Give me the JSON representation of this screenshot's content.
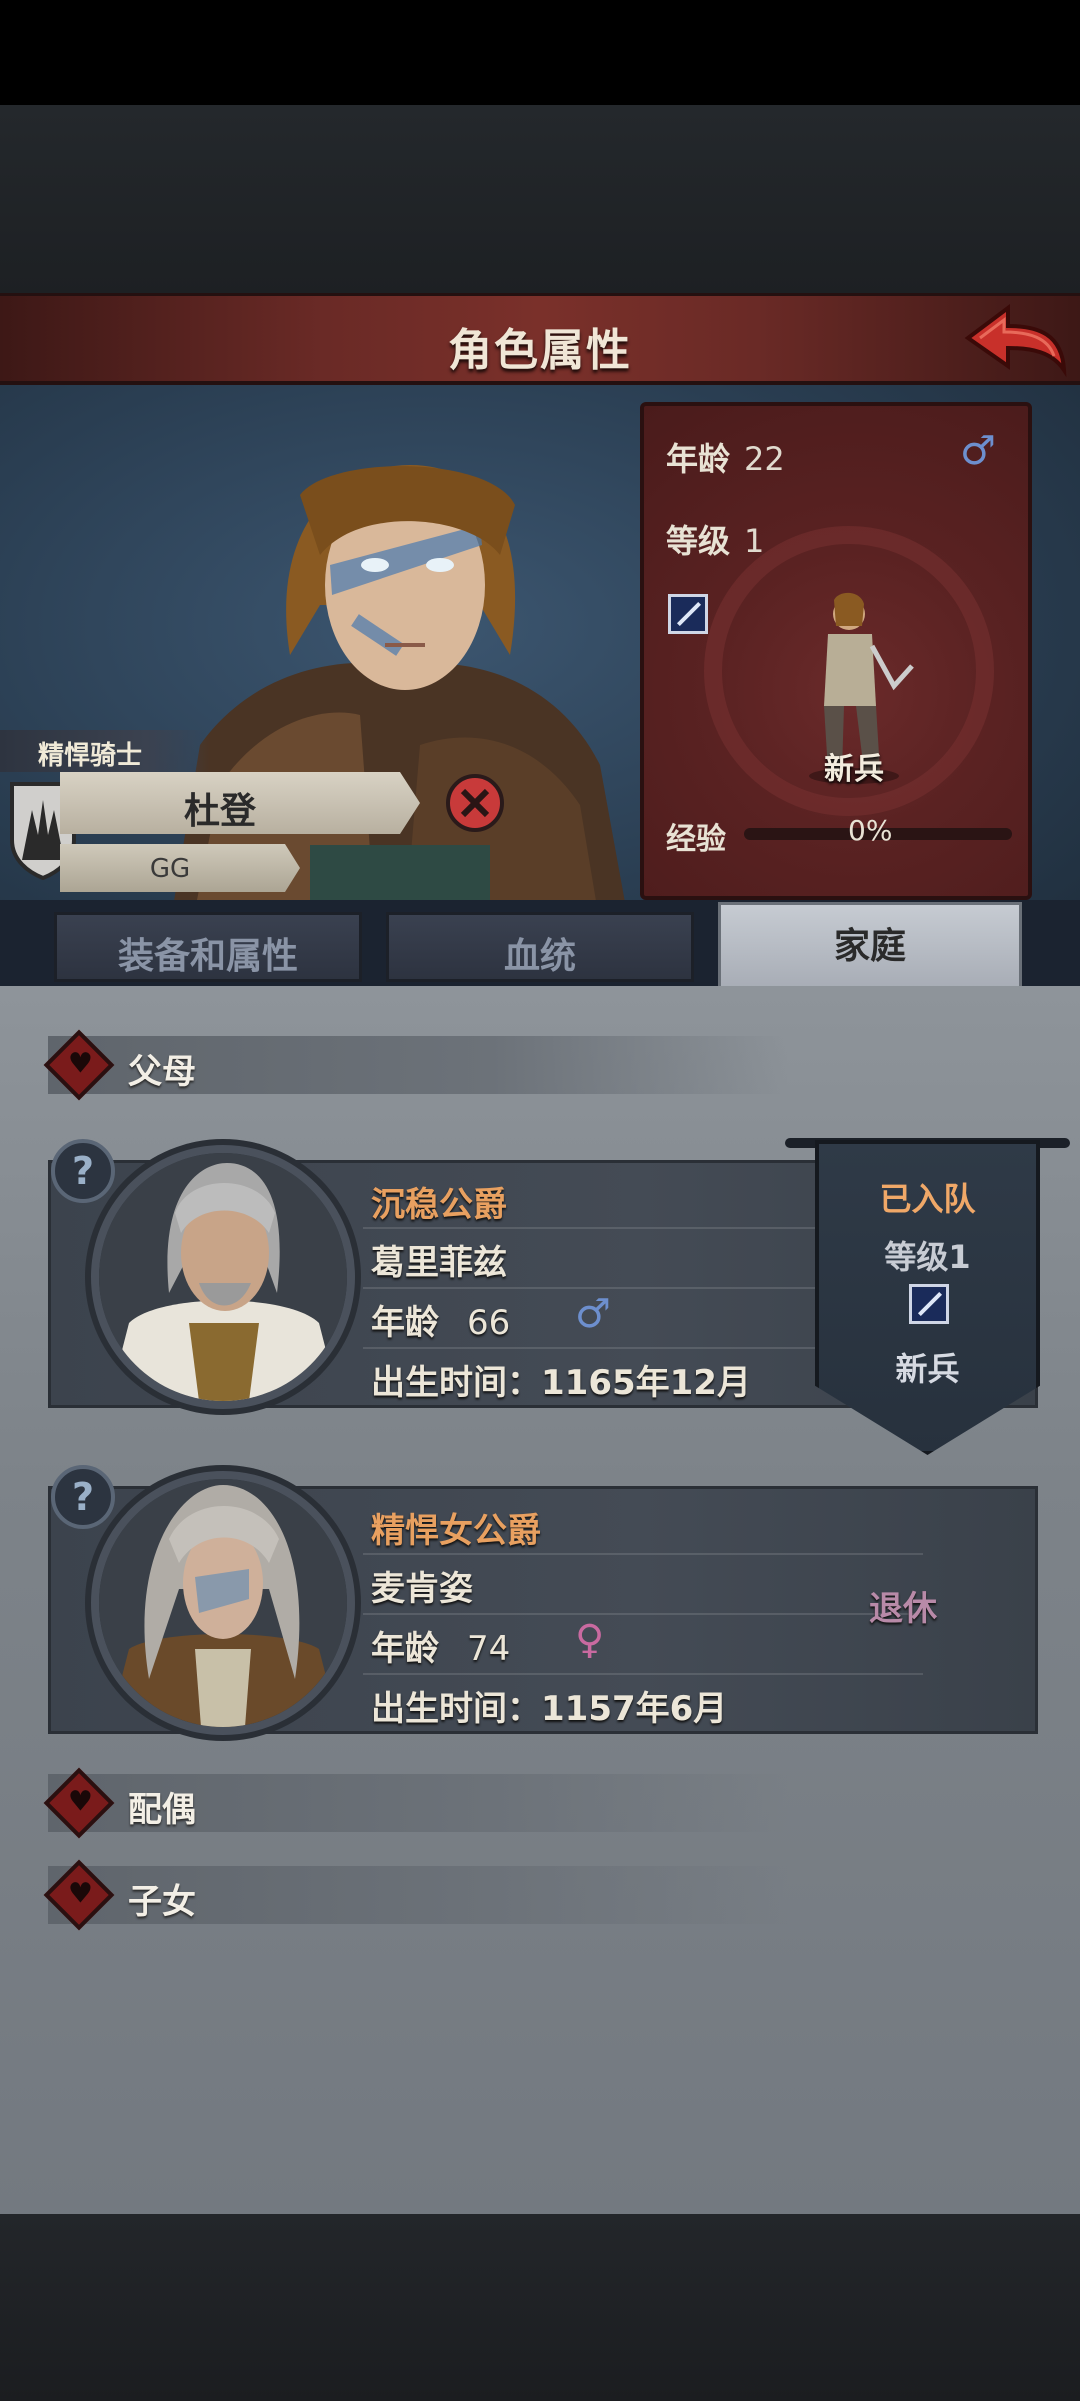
{
  "header": {
    "title": "角色属性"
  },
  "hero": {
    "class_label": "精悍骑士",
    "name": "杜登",
    "subtitle": "GG"
  },
  "stats": {
    "age_label": "年龄",
    "age_value": "22",
    "level_label": "等级",
    "level_value": "1",
    "sex_symbol": "♂",
    "unit_type": "新兵",
    "exp_label": "经验",
    "exp_value": "0%",
    "exp_progress": 0
  },
  "tabs": [
    {
      "label": "装备和属性",
      "active": false
    },
    {
      "label": "血统",
      "active": false
    },
    {
      "label": "家庭",
      "active": true
    }
  ],
  "family": {
    "parents_label": "父母",
    "spouse_label": "配偶",
    "children_label": "子女",
    "father": {
      "title": "沉稳公爵",
      "name": "葛里菲兹",
      "age_label": "年龄",
      "age_value": "66",
      "sex_symbol": "♂",
      "birth": "出生时间：1165年12月",
      "status_joined": "已入队",
      "status_level": "等级1",
      "status_unit": "新兵"
    },
    "mother": {
      "title": "精悍女公爵",
      "name": "麦肯姿",
      "age_label": "年龄",
      "age_value": "74",
      "sex_symbol": "♀",
      "birth": "出生时间：1157年6月",
      "status": "退休"
    }
  },
  "help_symbol": "?",
  "colors": {
    "accent_red": "#7a302a",
    "title_orange": "#e8a060",
    "male_blue": "#6d8fce",
    "female_pink": "#c96aa0"
  }
}
